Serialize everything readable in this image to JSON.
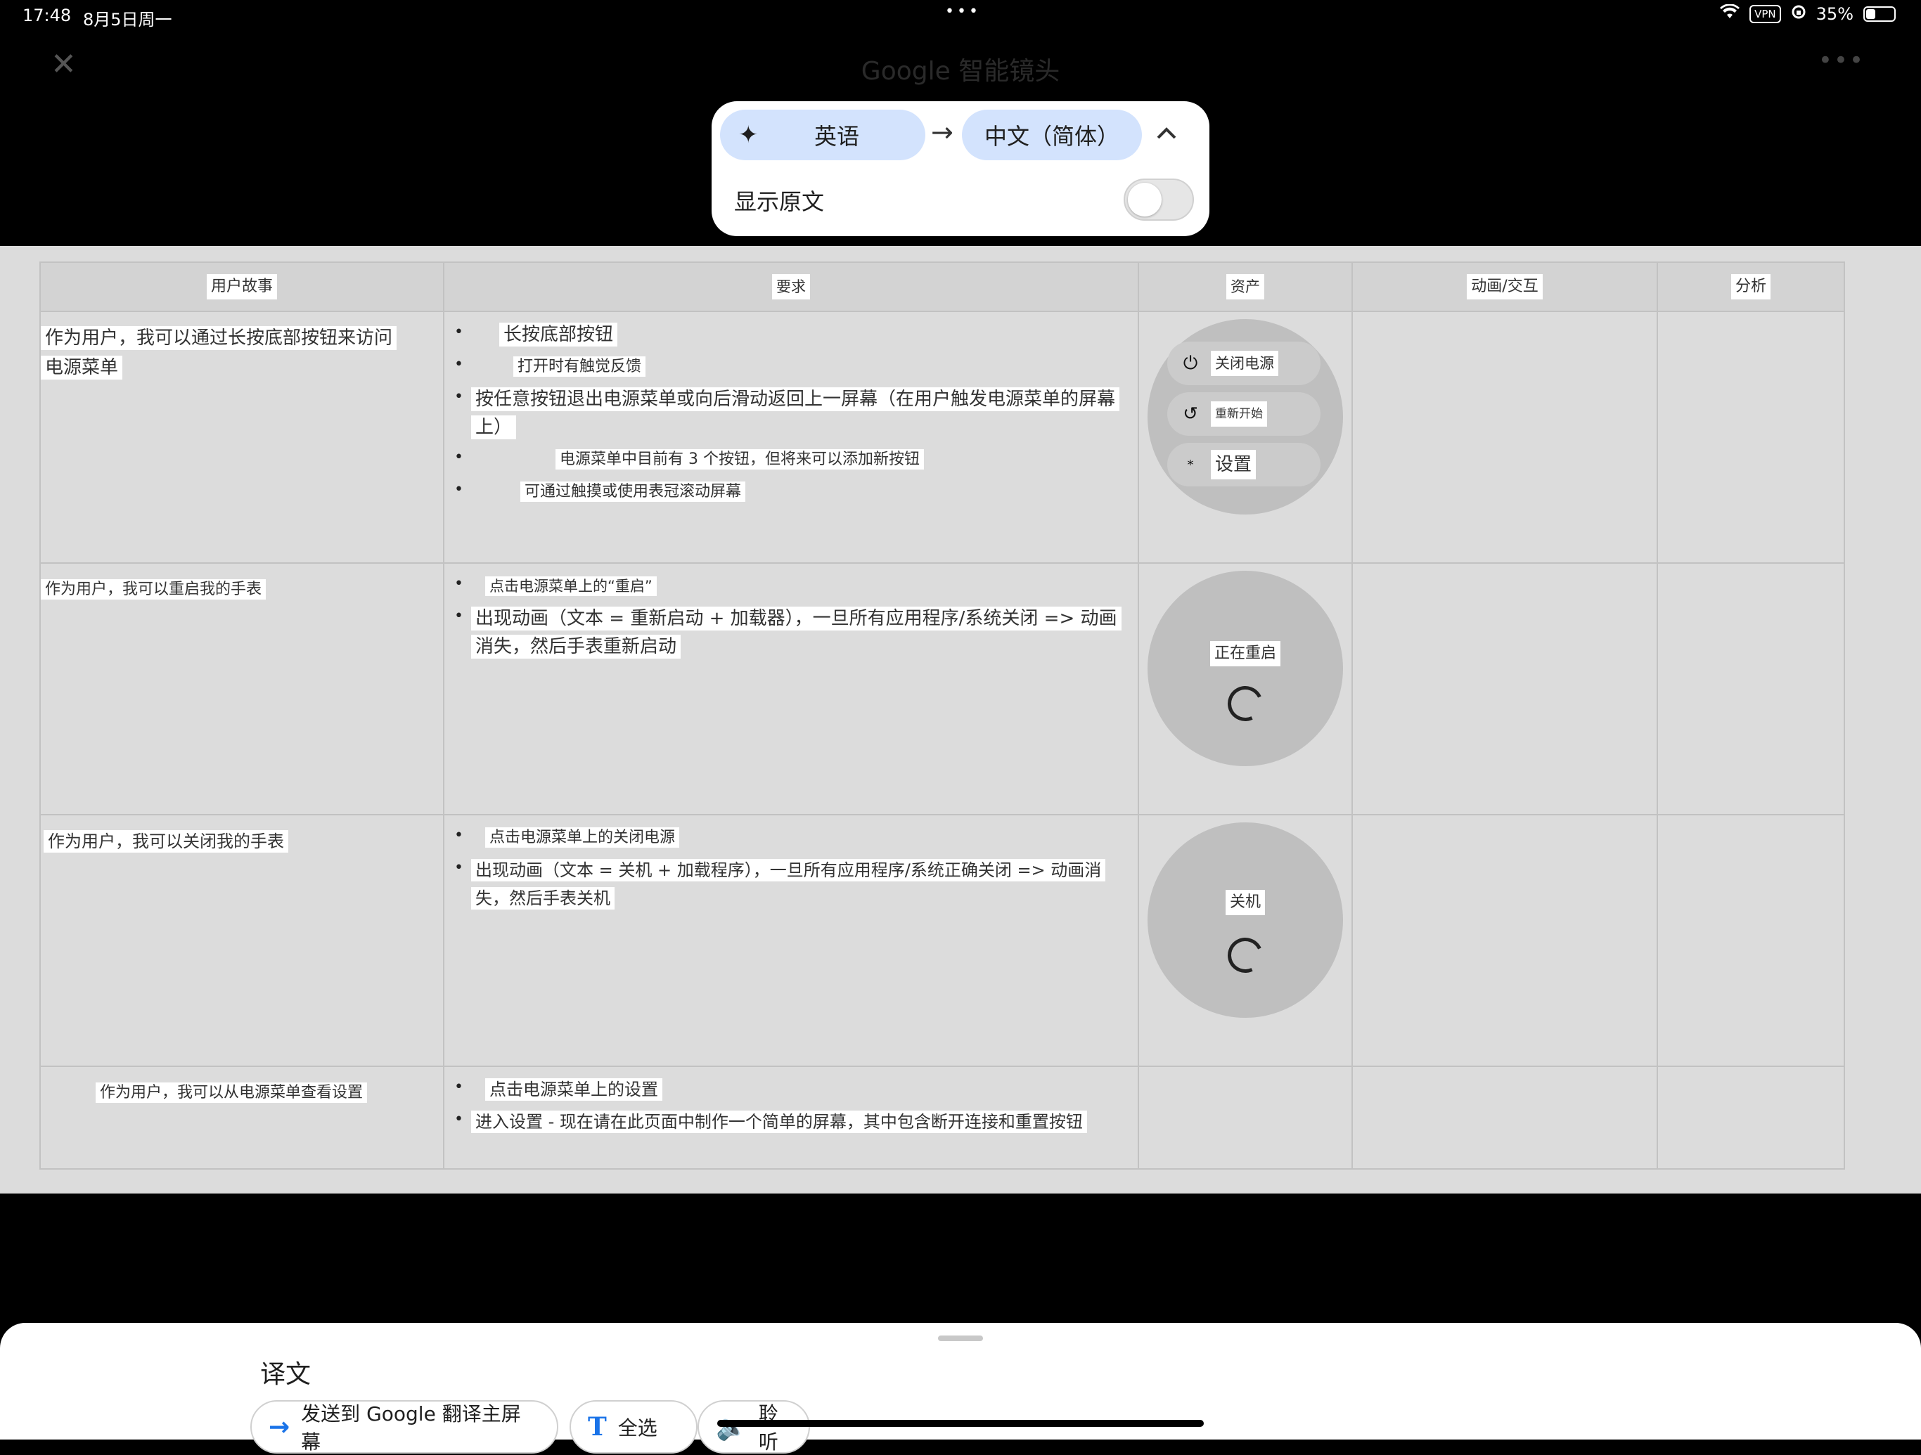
{
  "status_bar": {
    "time": "17:48",
    "date": "8月5日周一",
    "dots": "•••",
    "vpn": "VPN",
    "battery_text": "35%",
    "battery_level": 0.35
  },
  "header": {
    "title": "Google 智能镜头",
    "close_icon": "close-icon",
    "more_icon": "more-icon"
  },
  "language_panel": {
    "source_language": "英语",
    "target_language": "中文（简体）",
    "arrow": "→",
    "show_original_label": "显示原文",
    "show_original_on": false
  },
  "table": {
    "headers": [
      "用户故事",
      "要求",
      "资产",
      "动画/交互",
      "分析"
    ],
    "rows": [
      {
        "story": "作为用户，我可以通过长按底部按钮来访问电源菜单",
        "requirements": [
          "长按底部按钮",
          "打开时有触觉反馈",
          "按任意按钮退出电源菜单或向后滑动返回上一屏幕（在用户触发电源菜单的屏幕上）",
          "电源菜单中目前有 3 个按钮，但将来可以添加新按钮",
          "可通过触摸或使用表冠滚动屏幕"
        ],
        "asset_menu": [
          {
            "icon": "power-icon",
            "label": "关闭电源"
          },
          {
            "icon": "restart-icon",
            "label": "重新开始"
          },
          {
            "icon": "settings-icon",
            "label": "设置"
          }
        ]
      },
      {
        "story": "作为用户，我可以重启我的手表",
        "requirements": [
          "点击电源菜单上的“重启”",
          "出现动画（文本 = 重新启动 + 加载器），一旦所有应用程序/系统关闭 => 动画消失，然后手表重新启动"
        ],
        "asset_label": "正在重启"
      },
      {
        "story": "作为用户，我可以关闭我的手表",
        "requirements": [
          "点击电源菜单上的关闭电源",
          "出现动画（文本 = 关机 + 加载程序），一旦所有应用程序/系统正确关闭 => 动画消失，然后手表关机"
        ],
        "asset_label": "关机"
      },
      {
        "story": "作为用户，我可以从电源菜单查看设置",
        "requirements": [
          "点击电源菜单上的设置",
          "进入设置 - 现在请在此页面中制作一个简单的屏幕，其中包含断开连接和重置按钮"
        ]
      }
    ]
  },
  "bottom_sheet": {
    "title": "译文",
    "actions": [
      {
        "icon": "arrow-right-icon",
        "label": "发送到 Google 翻译主屏幕"
      },
      {
        "icon": "text-icon",
        "label": "全选"
      },
      {
        "icon": "speaker-icon",
        "label": "聆听"
      }
    ]
  },
  "colors": {
    "pill_bg": "#d3e3fd",
    "accent": "#1a73e8",
    "doc_bg": "#dcdcdc"
  }
}
